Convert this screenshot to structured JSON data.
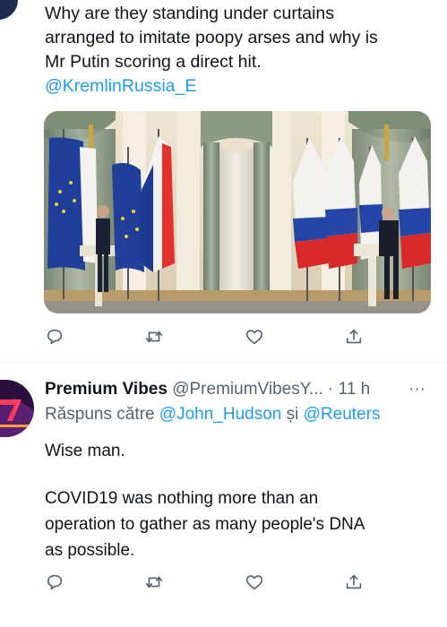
{
  "tweet1": {
    "lines": [
      "Why are they standing under curtains",
      "arranged to imitate poopy arses  and why is",
      "Mr Putin scoring a direct hit."
    ],
    "mention": "@KremlinRussia_E"
  },
  "reply": {
    "display_name": "Premium Vibes",
    "handle": "@PremiumVibesY...",
    "separator": "·",
    "time": "11 h",
    "more": "···",
    "reply_prefix": "Răspuns către",
    "reply_to_1": "@John_Hudson",
    "reply_joiner": "și",
    "reply_to_2": "@Reuters",
    "body_line1": "Wise man.",
    "body_line2": "COVID19 was nothing more than an",
    "body_line3": "operation to gather as many people's DNA",
    "body_line4": "as possible."
  },
  "icons": [
    "reply-icon",
    "retweet-icon",
    "like-icon",
    "share-icon"
  ],
  "colors": {
    "accent": "#1d9bf0",
    "muted": "#536471",
    "text": "#0f1419",
    "divider": "#eff3f4"
  }
}
